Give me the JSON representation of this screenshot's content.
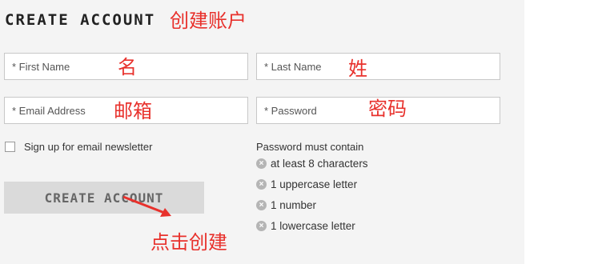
{
  "form": {
    "title": "CREATE ACCOUNT",
    "first_name_placeholder": "* First Name",
    "last_name_placeholder": "* Last Name",
    "email_placeholder": "* Email Address",
    "password_placeholder": "* Password",
    "newsletter_label": "Sign up for email newsletter",
    "submit_label": "CREATE ACCOUNT"
  },
  "password_rules": {
    "heading": "Password must contain",
    "items": [
      "at least 8 characters",
      "1 uppercase letter",
      "1 number",
      "1 lowercase letter"
    ],
    "icon": "×"
  },
  "annotations": {
    "title_note": "创建账户",
    "first_name_note": "名",
    "last_name_note": "姓",
    "email_note": "邮箱",
    "password_note": "密码",
    "submit_note": "点击创建"
  },
  "colors": {
    "annotation": "#e8312c",
    "panel_bg": "#f4f4f4",
    "button_bg": "#dadada"
  }
}
